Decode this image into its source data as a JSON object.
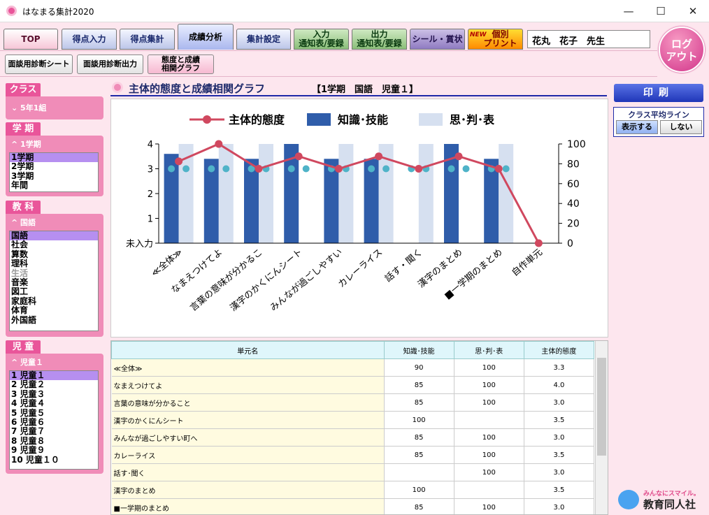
{
  "window": {
    "title": "はなまる集計2020",
    "minimize": "—",
    "maximize": "☐",
    "close": "✕"
  },
  "tabs": [
    {
      "label": "TOP",
      "style": "pink"
    },
    {
      "label": "得点入力",
      "style": "blue"
    },
    {
      "label": "得点集計",
      "style": "blue"
    },
    {
      "label": "成績分析",
      "style": "active"
    },
    {
      "label": "集計設定",
      "style": "blue"
    },
    {
      "label": "入力\n通知表/要録",
      "style": "green"
    },
    {
      "label": "出力\n通知表/要録",
      "style": "green"
    },
    {
      "label": "シール・賞状",
      "style": "purple"
    },
    {
      "label": "個別\nプリント",
      "style": "new",
      "badge": "NEW"
    }
  ],
  "teacher": "花丸　花子　先生",
  "logout": "ログ\nアウト",
  "subtabs": [
    "面談用診断シート",
    "面談用診断出力",
    "態度と成績\n相関グラフ"
  ],
  "sidebar": {
    "class": {
      "header": "クラス",
      "current": "5年1組"
    },
    "term": {
      "header": "学 期",
      "current": "1学期",
      "items": [
        "1学期",
        "2学期",
        "3学期",
        "年間"
      ]
    },
    "subject": {
      "header": "教 科",
      "current": "国語",
      "items": [
        "国語",
        "社会",
        "算数",
        "理科",
        "生活",
        "音楽",
        "図工",
        "家庭科",
        "体育",
        "外国語"
      ]
    },
    "student": {
      "header": "児 童",
      "current": "児童１",
      "items": [
        "1  児童１",
        "2  児童２",
        "3  児童３",
        "4  児童４",
        "5  児童５",
        "6  児童６",
        "7  児童７",
        "8  児童８",
        "9  児童９",
        "10  児童１０"
      ]
    }
  },
  "main": {
    "title": "主体的態度と成績相関グラフ",
    "condition": "【1学期　国語　児童１】"
  },
  "print": "印刷",
  "avg_line": {
    "label": "クラス平均ライン",
    "show": "表示する",
    "hide": "しない"
  },
  "table": {
    "headers": [
      "単元名",
      "知識･技能",
      "思･判･表",
      "主体的態度"
    ],
    "rows": [
      [
        "≪全体≫",
        "90",
        "100",
        "3.3"
      ],
      [
        "なまえつけてよ",
        "85",
        "100",
        "4.0"
      ],
      [
        "言葉の意味が分かること",
        "85",
        "100",
        "3.0"
      ],
      [
        "漢字のかくにんシート",
        "100",
        "",
        "3.5"
      ],
      [
        "みんなが過ごしやすい町へ",
        "85",
        "100",
        "3.0"
      ],
      [
        "カレーライス",
        "85",
        "100",
        "3.5"
      ],
      [
        "話す･聞く",
        "",
        "100",
        "3.0"
      ],
      [
        "漢字のまとめ",
        "100",
        "",
        "3.5"
      ],
      [
        "■一学期のまとめ",
        "85",
        "100",
        "3.0"
      ]
    ]
  },
  "logo": {
    "slogan": "みんなにスマイル。",
    "company": "教育同人社"
  },
  "chart_data": {
    "type": "bar",
    "categories": [
      "≪全体≫",
      "なまえつけてよ",
      "言葉の意味が分かるこ",
      "漢字のかくにんシート",
      "みんなが過ごしやすい",
      "カレーライス",
      "話す・聞く",
      "漢字のまとめ",
      "■一学期のまとめ",
      "自作単元"
    ],
    "series": [
      {
        "name": "主体的態度",
        "type": "line",
        "axis": "left",
        "values": [
          3.3,
          4.0,
          3.0,
          3.5,
          3.0,
          3.5,
          3.0,
          3.5,
          3.0,
          0
        ],
        "color": "#d0485f"
      },
      {
        "name": "知識･技能",
        "type": "bar",
        "axis": "right",
        "values": [
          90,
          85,
          85,
          100,
          85,
          85,
          null,
          100,
          85,
          null
        ],
        "color": "#2f5daa"
      },
      {
        "name": "思･判･表",
        "type": "bar",
        "axis": "right",
        "values": [
          100,
          100,
          100,
          null,
          100,
          100,
          100,
          null,
          100,
          null
        ],
        "color": "#d6e0f0"
      }
    ],
    "class_average": {
      "values": [
        75,
        75,
        75,
        75,
        75,
        75,
        75,
        75,
        75,
        null
      ],
      "color": "#4fb3c8"
    },
    "left_ticks": [
      "未入力",
      "1",
      "2",
      "3",
      "4"
    ],
    "left_range": [
      0,
      4
    ],
    "right_ticks": [
      "0",
      "20",
      "40",
      "60",
      "80",
      "100"
    ],
    "right_range": [
      0,
      100
    ],
    "legend": "top"
  }
}
